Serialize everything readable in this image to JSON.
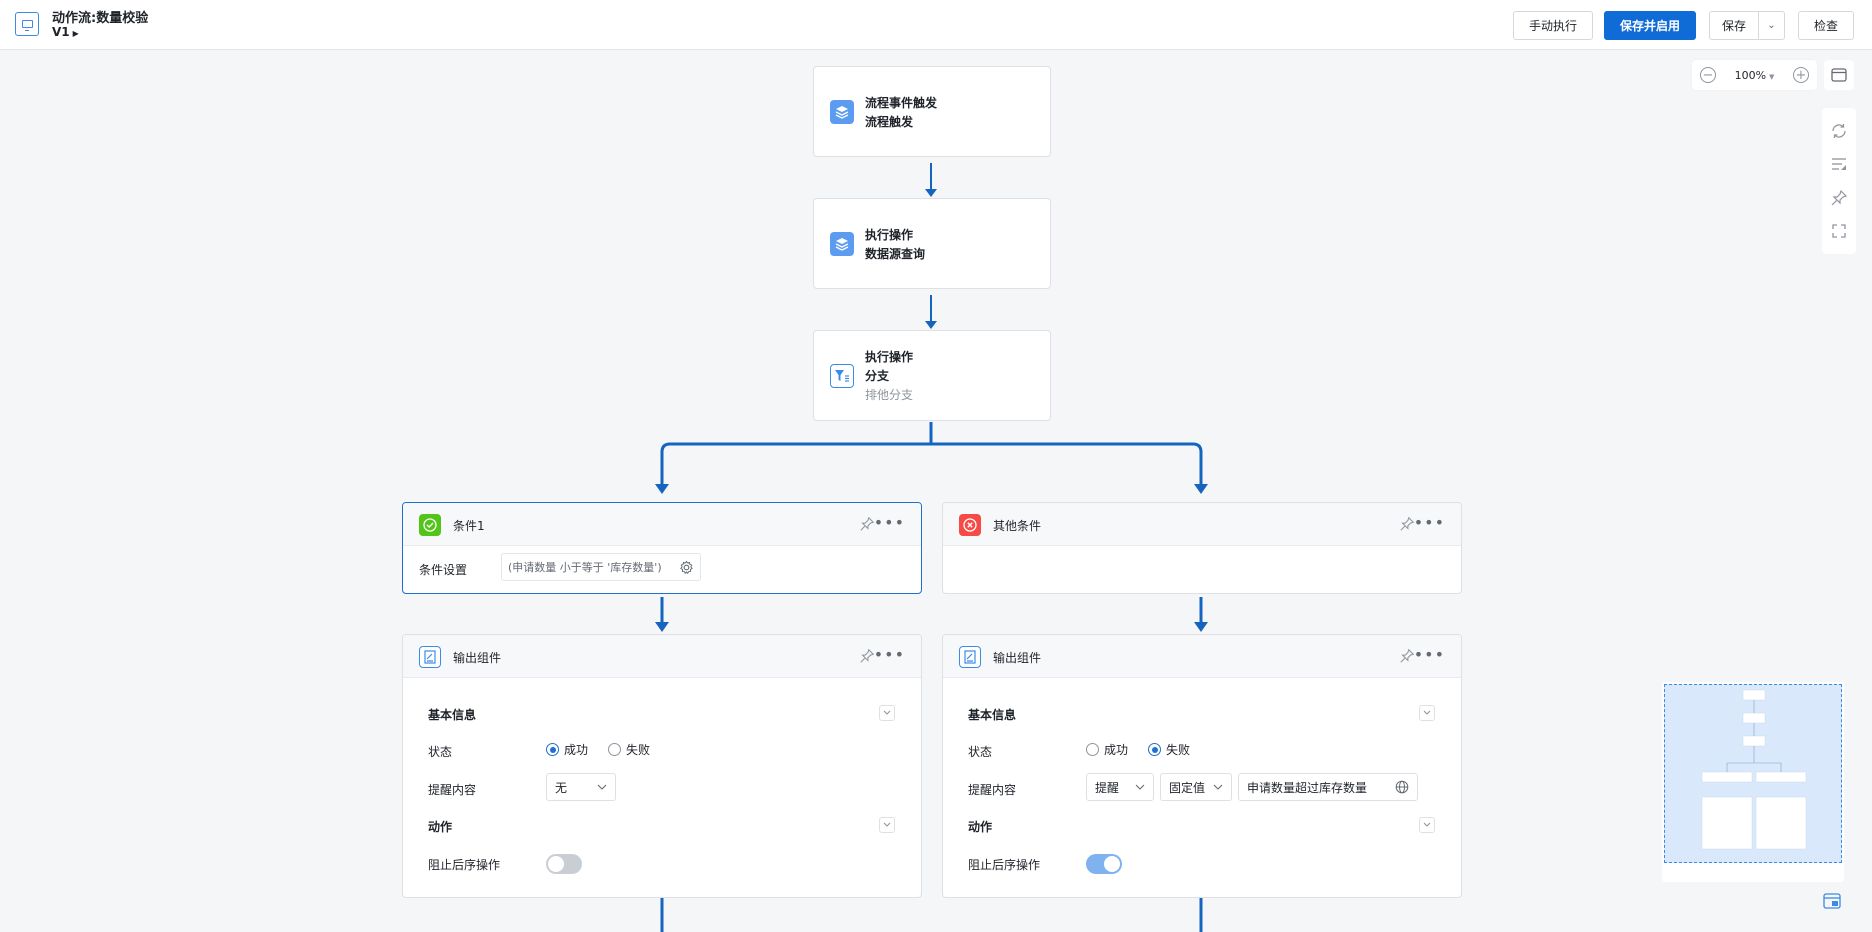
{
  "header": {
    "title": "动作流:数量校验",
    "version": "V1",
    "buttons": {
      "manual_run": "手动执行",
      "save_enable": "保存并启用",
      "save": "保存",
      "check": "检查"
    }
  },
  "zoom": {
    "level": "100%"
  },
  "colors": {
    "accent": "#0f6bd6",
    "success": "#52c41a",
    "danger": "#f54a45"
  },
  "nodes": [
    {
      "line1": "流程事件触发",
      "line2": "流程触发",
      "icon": "layers-icon"
    },
    {
      "line1": "执行操作",
      "line2": "数据源查询",
      "icon": "layers-icon"
    },
    {
      "line1": "执行操作",
      "line2": "分支",
      "line3": "排他分支",
      "icon": "filter-icon"
    }
  ],
  "branches": [
    {
      "title": "条件1",
      "condition_label": "条件设置",
      "condition_value": "(申请数量 小于等于 '库存数量')"
    },
    {
      "title": "其他条件"
    }
  ],
  "outputs": [
    {
      "title": "输出组件",
      "basic_info": "基本信息",
      "status_label": "状态",
      "status_options": [
        "成功",
        "失败"
      ],
      "status_selected": "成功",
      "reminder_label": "提醒内容",
      "reminder_value": "无",
      "action_title": "动作",
      "block_label": "阻止后序操作",
      "block_enabled": false
    },
    {
      "title": "输出组件",
      "basic_info": "基本信息",
      "status_label": "状态",
      "status_options": [
        "成功",
        "失败"
      ],
      "status_selected": "失败",
      "reminder_label": "提醒内容",
      "reminder_type": "提醒",
      "reminder_source": "固定值",
      "reminder_text": "申请数量超过库存数量",
      "action_title": "动作",
      "block_label": "阻止后序操作",
      "block_enabled": true
    }
  ]
}
